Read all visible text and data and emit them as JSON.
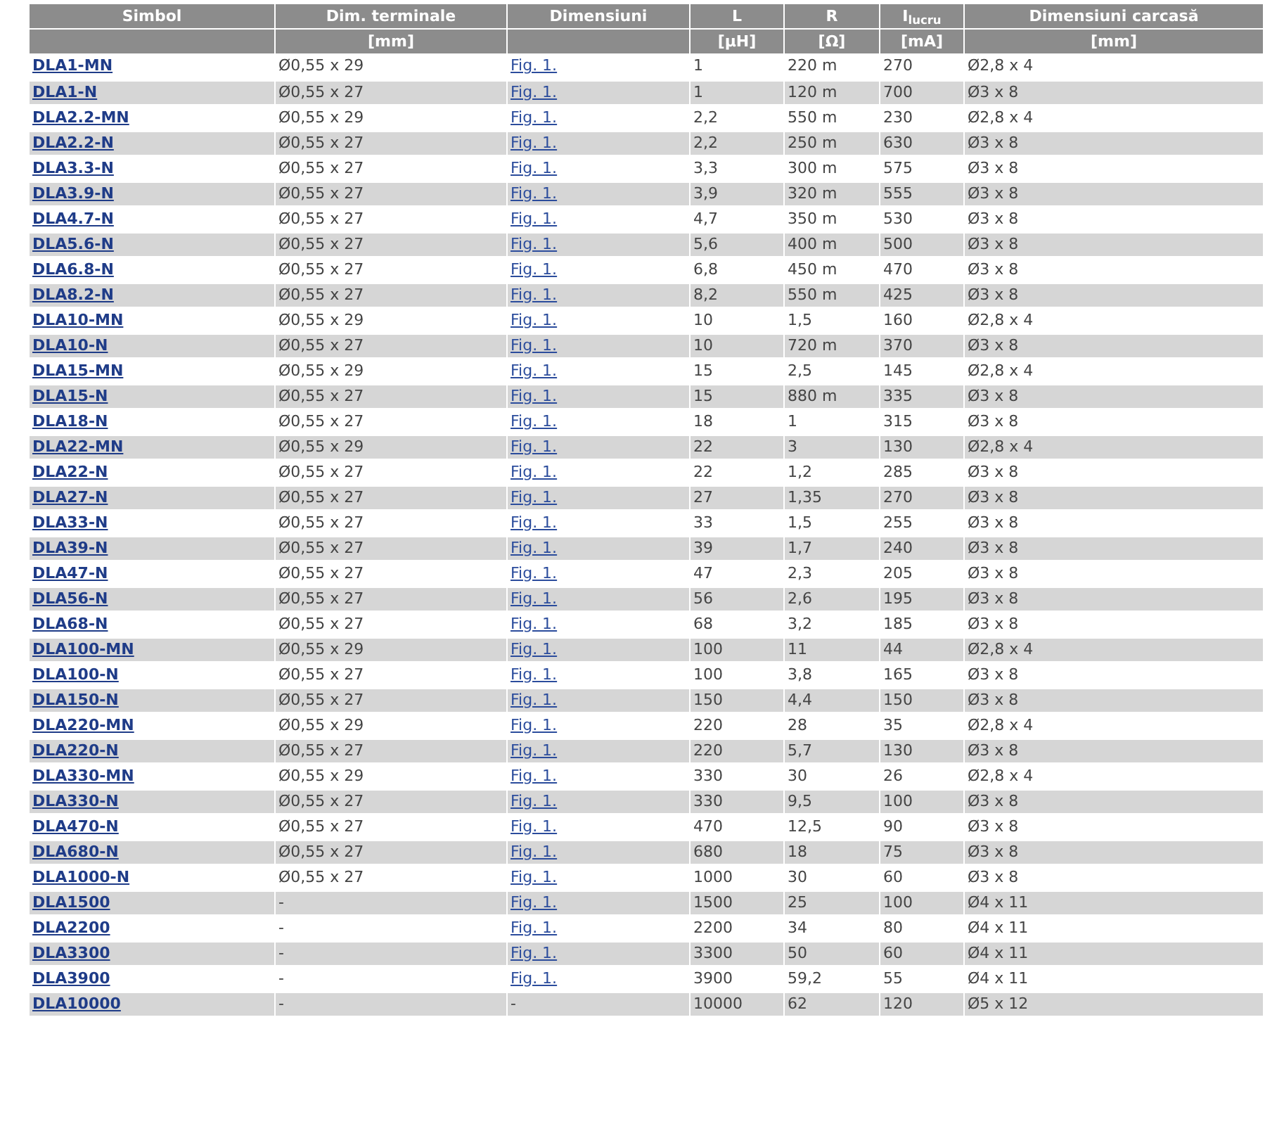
{
  "table": {
    "columns": [
      {
        "heading": "Simbol"
      },
      {
        "heading": "Dim. terminale",
        "unit": "[mm]"
      },
      {
        "heading": "Dimensiuni"
      },
      {
        "heading": "L",
        "unit": "[µH]"
      },
      {
        "heading": "R",
        "unit": "[Ω]"
      },
      {
        "heading": "I$_{lucru}$",
        "unit": "[mA]"
      },
      {
        "heading": "Dimensiuni carcasă",
        "unit": "[mm]"
      }
    ],
    "rows": [
      {
        "cells": [
          "DLA1-MN",
          "Ø0,55 x 29",
          "Fig. 1.",
          "1",
          "220 m",
          "270",
          "Ø2,8 x 4"
        ],
        "figure_link": true
      },
      {
        "cells": [
          "DLA1-N",
          "Ø0,55 x 27",
          "Fig. 1.",
          "1",
          "120 m",
          "700",
          "Ø3 x 8"
        ],
        "figure_link": true
      },
      {
        "cells": [
          "DLA2.2-MN",
          "Ø0,55 x 29",
          "Fig. 1.",
          "2,2",
          "550 m",
          "230",
          "Ø2,8 x 4"
        ],
        "figure_link": true
      },
      {
        "cells": [
          "DLA2.2-N",
          "Ø0,55 x 27",
          "Fig. 1.",
          "2,2",
          "250 m",
          "630",
          "Ø3 x 8"
        ],
        "figure_link": true
      },
      {
        "cells": [
          "DLA3.3-N",
          "Ø0,55 x 27",
          "Fig. 1.",
          "3,3",
          "300 m",
          "575",
          "Ø3 x 8"
        ],
        "figure_link": true
      },
      {
        "cells": [
          "DLA3.9-N",
          "Ø0,55 x 27",
          "Fig. 1.",
          "3,9",
          "320 m",
          "555",
          "Ø3 x 8"
        ],
        "figure_link": true
      },
      {
        "cells": [
          "DLA4.7-N",
          "Ø0,55 x 27",
          "Fig. 1.",
          "4,7",
          "350 m",
          "530",
          "Ø3 x 8"
        ],
        "figure_link": true
      },
      {
        "cells": [
          "DLA5.6-N",
          "Ø0,55 x 27",
          "Fig. 1.",
          "5,6",
          "400 m",
          "500",
          "Ø3 x 8"
        ],
        "figure_link": true
      },
      {
        "cells": [
          "DLA6.8-N",
          "Ø0,55 x 27",
          "Fig. 1.",
          "6,8",
          "450 m",
          "470",
          "Ø3 x 8"
        ],
        "figure_link": true
      },
      {
        "cells": [
          "DLA8.2-N",
          "Ø0,55 x 27",
          "Fig. 1.",
          "8,2",
          "550 m",
          "425",
          "Ø3 x 8"
        ],
        "figure_link": true
      },
      {
        "cells": [
          "DLA10-MN",
          "Ø0,55 x 29",
          "Fig. 1.",
          "10",
          "1,5",
          "160",
          "Ø2,8 x 4"
        ],
        "figure_link": true
      },
      {
        "cells": [
          "DLA10-N",
          "Ø0,55 x 27",
          "Fig. 1.",
          "10",
          "720 m",
          "370",
          "Ø3 x 8"
        ],
        "figure_link": true
      },
      {
        "cells": [
          "DLA15-MN",
          "Ø0,55 x 29",
          "Fig. 1.",
          "15",
          "2,5",
          "145",
          "Ø2,8 x 4"
        ],
        "figure_link": true
      },
      {
        "cells": [
          "DLA15-N",
          "Ø0,55 x 27",
          "Fig. 1.",
          "15",
          "880 m",
          "335",
          "Ø3 x 8"
        ],
        "figure_link": true
      },
      {
        "cells": [
          "DLA18-N",
          "Ø0,55 x 27",
          "Fig. 1.",
          "18",
          "1",
          "315",
          "Ø3 x 8"
        ],
        "figure_link": true
      },
      {
        "cells": [
          "DLA22-MN",
          "Ø0,55 x 29",
          "Fig. 1.",
          "22",
          "3",
          "130",
          "Ø2,8 x 4"
        ],
        "figure_link": true
      },
      {
        "cells": [
          "DLA22-N",
          "Ø0,55 x 27",
          "Fig. 1.",
          "22",
          "1,2",
          "285",
          "Ø3 x 8"
        ],
        "figure_link": true
      },
      {
        "cells": [
          "DLA27-N",
          "Ø0,55 x 27",
          "Fig. 1.",
          "27",
          "1,35",
          "270",
          "Ø3 x 8"
        ],
        "figure_link": true
      },
      {
        "cells": [
          "DLA33-N",
          "Ø0,55 x 27",
          "Fig. 1.",
          "33",
          "1,5",
          "255",
          "Ø3 x 8"
        ],
        "figure_link": true
      },
      {
        "cells": [
          "DLA39-N",
          "Ø0,55 x 27",
          "Fig. 1.",
          "39",
          "1,7",
          "240",
          "Ø3 x 8"
        ],
        "figure_link": true
      },
      {
        "cells": [
          "DLA47-N",
          "Ø0,55 x 27",
          "Fig. 1.",
          "47",
          "2,3",
          "205",
          "Ø3 x 8"
        ],
        "figure_link": true
      },
      {
        "cells": [
          "DLA56-N",
          "Ø0,55 x 27",
          "Fig. 1.",
          "56",
          "2,6",
          "195",
          "Ø3 x 8"
        ],
        "figure_link": true
      },
      {
        "cells": [
          "DLA68-N",
          "Ø0,55 x 27",
          "Fig. 1.",
          "68",
          "3,2",
          "185",
          "Ø3 x 8"
        ],
        "figure_link": true
      },
      {
        "cells": [
          "DLA100-MN",
          "Ø0,55 x 29",
          "Fig. 1.",
          "100",
          "11",
          "44",
          "Ø2,8 x 4"
        ],
        "figure_link": true
      },
      {
        "cells": [
          "DLA100-N",
          "Ø0,55 x 27",
          "Fig. 1.",
          "100",
          "3,8",
          "165",
          "Ø3 x 8"
        ],
        "figure_link": true
      },
      {
        "cells": [
          "DLA150-N",
          "Ø0,55 x 27",
          "Fig. 1.",
          "150",
          "4,4",
          "150",
          "Ø3 x 8"
        ],
        "figure_link": true
      },
      {
        "cells": [
          "DLA220-MN",
          "Ø0,55 x 29",
          "Fig. 1.",
          "220",
          "28",
          "35",
          "Ø2,8 x 4"
        ],
        "figure_link": true
      },
      {
        "cells": [
          "DLA220-N",
          "Ø0,55 x 27",
          "Fig. 1.",
          "220",
          "5,7",
          "130",
          "Ø3 x 8"
        ],
        "figure_link": true
      },
      {
        "cells": [
          "DLA330-MN",
          "Ø0,55 x 29",
          "Fig. 1.",
          "330",
          "30",
          "26",
          "Ø2,8 x 4"
        ],
        "figure_link": true
      },
      {
        "cells": [
          "DLA330-N",
          "Ø0,55 x 27",
          "Fig. 1.",
          "330",
          "9,5",
          "100",
          "Ø3 x 8"
        ],
        "figure_link": true
      },
      {
        "cells": [
          "DLA470-N",
          "Ø0,55 x 27",
          "Fig. 1.",
          "470",
          "12,5",
          "90",
          "Ø3 x 8"
        ],
        "figure_link": true
      },
      {
        "cells": [
          "DLA680-N",
          "Ø0,55 x 27",
          "Fig. 1.",
          "680",
          "18",
          "75",
          "Ø3 x 8"
        ],
        "figure_link": true
      },
      {
        "cells": [
          "DLA1000-N",
          "Ø0,55 x 27",
          "Fig. 1.",
          "1000",
          "30",
          "60",
          "Ø3 x 8"
        ],
        "figure_link": true
      },
      {
        "cells": [
          "DLA1500",
          "-",
          "Fig. 1.",
          "1500",
          "25",
          "100",
          "Ø4 x 11"
        ],
        "figure_link": true
      },
      {
        "cells": [
          "DLA2200",
          "-",
          "Fig. 1.",
          "2200",
          "34",
          "80",
          "Ø4 x 11"
        ],
        "figure_link": true
      },
      {
        "cells": [
          "DLA3300",
          "-",
          "Fig. 1.",
          "3300",
          "50",
          "60",
          "Ø4 x 11"
        ],
        "figure_link": true
      },
      {
        "cells": [
          "DLA3900",
          "-",
          "Fig. 1.",
          "3900",
          "59,2",
          "55",
          "Ø4 x 11"
        ],
        "figure_link": true
      },
      {
        "cells": [
          "DLA10000",
          "-",
          "-",
          "10000",
          "62",
          "120",
          "Ø5 x 12"
        ],
        "figure_link": false
      }
    ]
  }
}
